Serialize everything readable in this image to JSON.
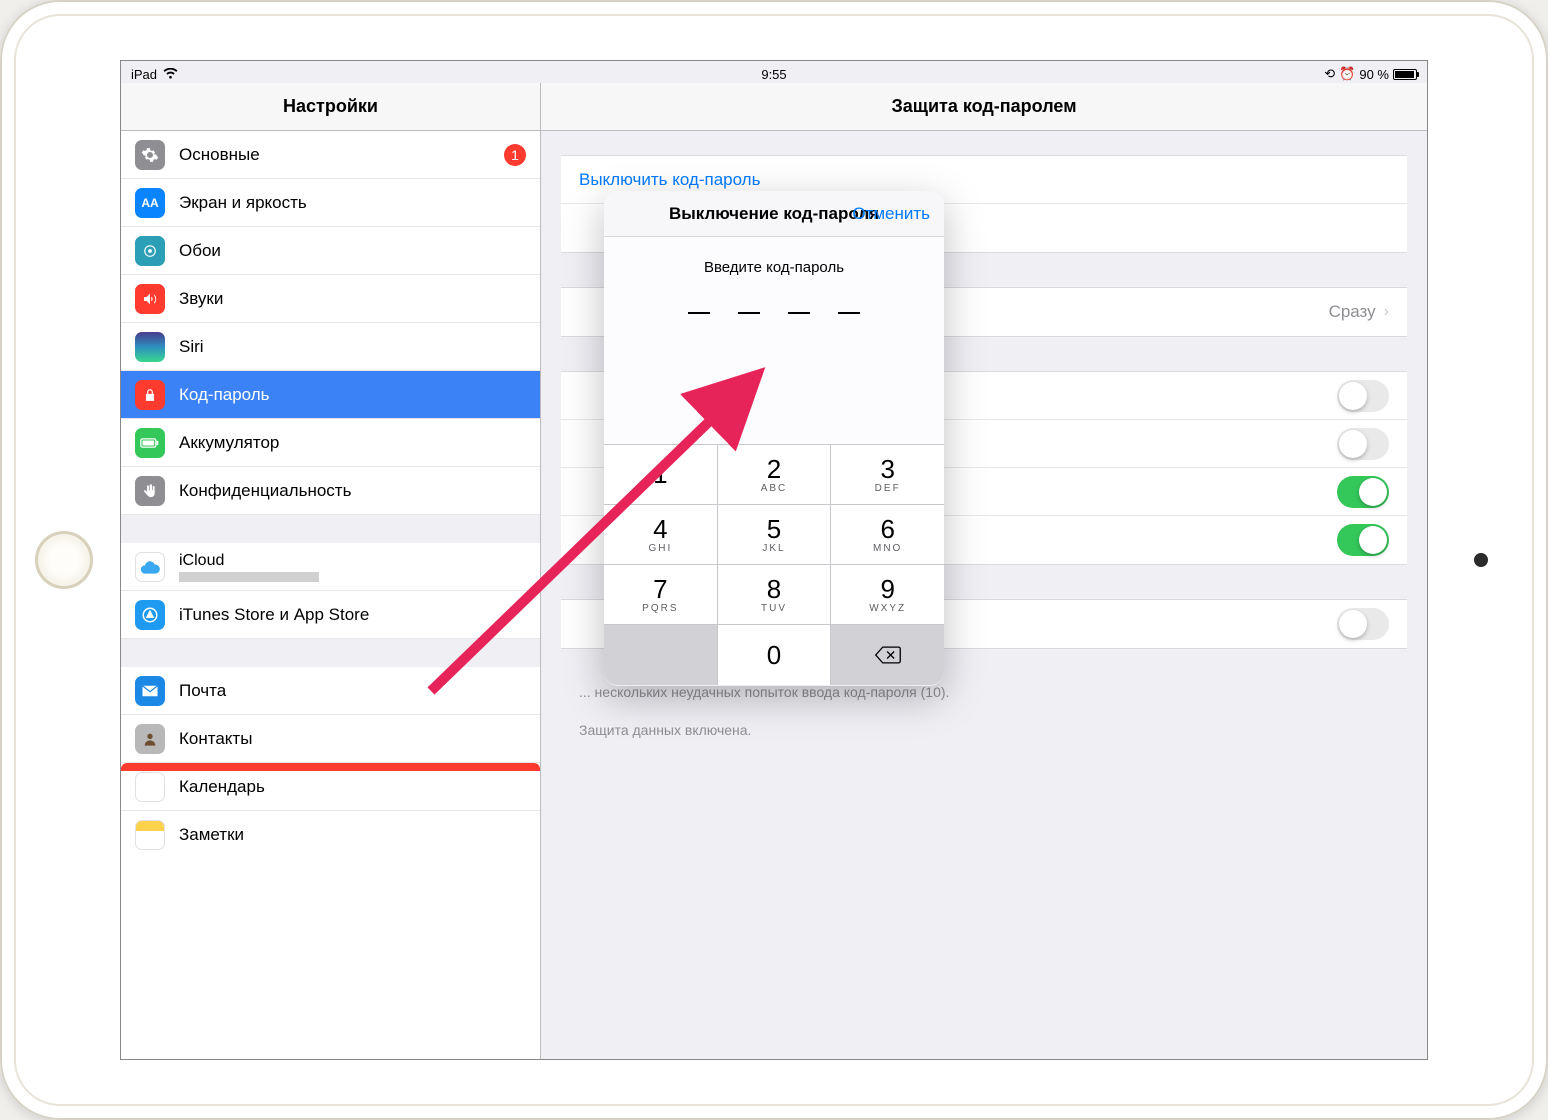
{
  "status": {
    "device": "iPad",
    "time": "9:55",
    "battery_pct": "90 %"
  },
  "left_title": "Настройки",
  "right_title": "Защита код-паролем",
  "sidebar": [
    {
      "label": "Основные",
      "badge": "1",
      "icon": "gear"
    },
    {
      "label": "Экран и яркость",
      "icon": "aa"
    },
    {
      "label": "Обои",
      "icon": "wallpaper"
    },
    {
      "label": "Звуки",
      "icon": "speaker"
    },
    {
      "label": "Siri",
      "icon": "siri"
    },
    {
      "label": "Код-пароль",
      "icon": "lock",
      "selected": true
    },
    {
      "label": "Аккумулятор",
      "icon": "battery"
    },
    {
      "label": "Конфиденциальность",
      "icon": "hand"
    }
  ],
  "sidebar2": [
    {
      "label": "iCloud",
      "icon": "cloud",
      "sub": ""
    },
    {
      "label": "iTunes Store и App Store",
      "icon": "appstore"
    }
  ],
  "sidebar3": [
    {
      "label": "Почта",
      "icon": "mail"
    },
    {
      "label": "Контакты",
      "icon": "contacts"
    },
    {
      "label": "Календарь",
      "icon": "calendar"
    },
    {
      "label": "Заметки",
      "icon": "notes"
    }
  ],
  "right_pane": {
    "disable_link": "Выключить код-пароль",
    "require_label": "",
    "require_value": "Сразу",
    "footer1": "... нескольких неудачных попыток ввода код-пароля (10).",
    "footer2": "Защита данных включена."
  },
  "popover": {
    "title": "Выключение код-пароля",
    "cancel": "Отменить",
    "prompt": "Введите код-пароль",
    "keypad": [
      [
        {
          "d": "1",
          "l": ""
        },
        {
          "d": "2",
          "l": "ABC"
        },
        {
          "d": "3",
          "l": "DEF"
        }
      ],
      [
        {
          "d": "4",
          "l": "GHI"
        },
        {
          "d": "5",
          "l": "JKL"
        },
        {
          "d": "6",
          "l": "MNO"
        }
      ],
      [
        {
          "d": "7",
          "l": "PQRS"
        },
        {
          "d": "8",
          "l": "TUV"
        },
        {
          "d": "9",
          "l": "WXYZ"
        }
      ]
    ],
    "zero": "0"
  }
}
